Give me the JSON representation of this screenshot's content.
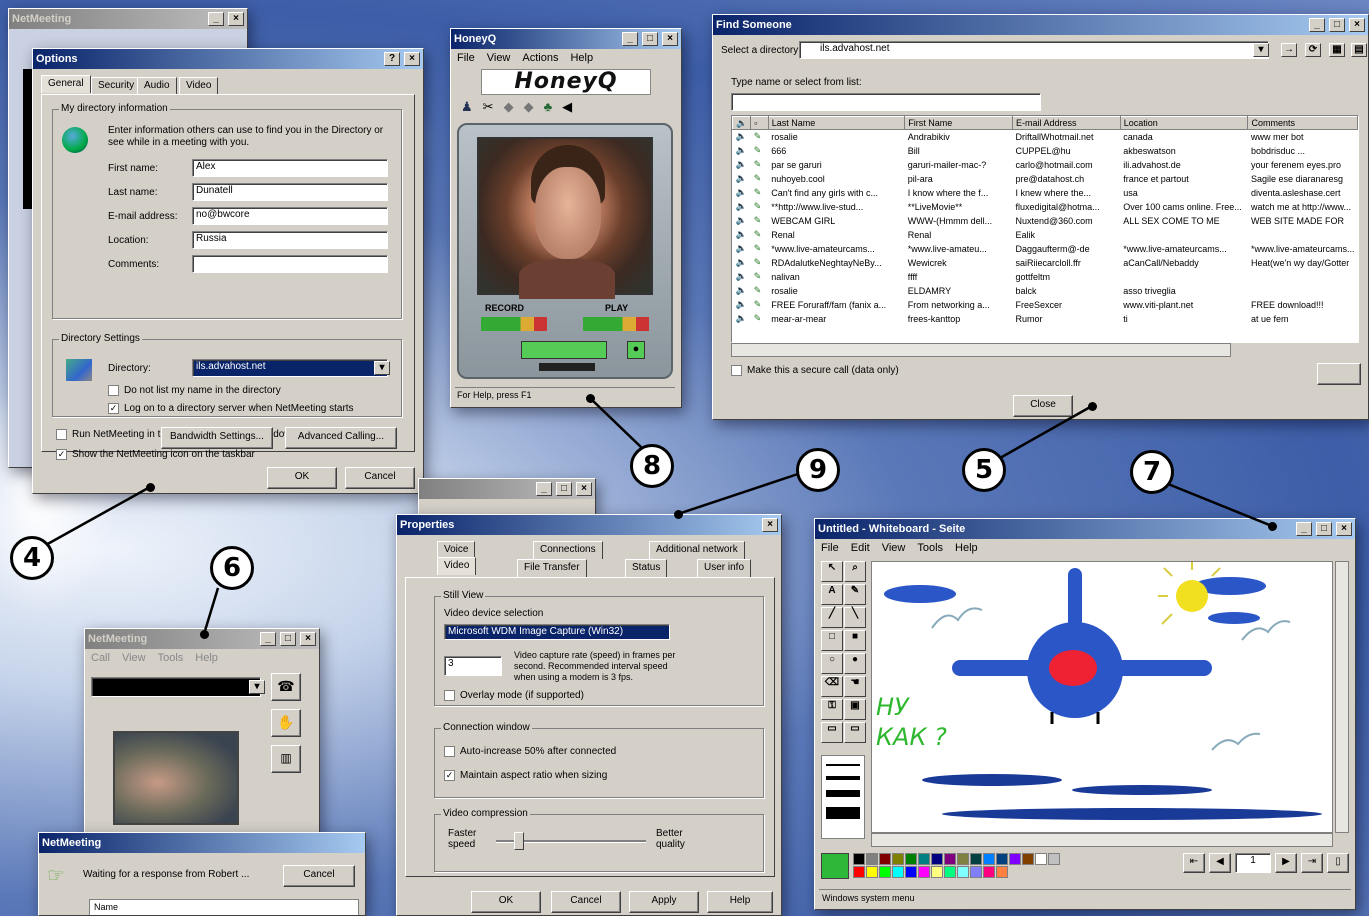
{
  "callouts": [
    "4",
    "5",
    "6",
    "7",
    "8",
    "9"
  ],
  "options": {
    "title": "Options",
    "tabs": [
      "General",
      "Security",
      "Audio",
      "Video"
    ],
    "my_dir_group": "My directory information",
    "intro": "Enter information others can use to find you in the Directory or see while in a meeting with you.",
    "fields": [
      {
        "label": "First name:",
        "value": "Alex"
      },
      {
        "label": "Last name:",
        "value": "Dunatell"
      },
      {
        "label": "E-mail address:",
        "value": "no@bwcore"
      },
      {
        "label": "Location:",
        "value": "Russia"
      },
      {
        "label": "Comments:",
        "value": ""
      }
    ],
    "dir_group": "Directory Settings",
    "dir_label": "Directory:",
    "dir_value": "ils.advahost.net",
    "chk1": "Do not list my name in the directory",
    "chk2": "Log on to a directory server when NetMeeting starts",
    "chk3": "Run NetMeeting in the background when Windows starts",
    "chk4": "Show the NetMeeting icon on the taskbar",
    "bandwidth": "Bandwidth Settings...",
    "advanced": "Advanced Calling...",
    "ok": "OK",
    "cancel": "Cancel"
  },
  "honeyq": {
    "title": "HoneyQ",
    "menu": [
      "File",
      "View",
      "Actions",
      "Help"
    ],
    "logo": "HoneyQ",
    "record": "RECORD",
    "play": "PLAY",
    "status": "For Help, press F1"
  },
  "find": {
    "title": "Find Someone",
    "dir_label": "Select a directory:",
    "dir_value": "ils.advahost.net",
    "search_label": "Type name or select from list:",
    "search_value": "",
    "columns": [
      "Last Name",
      "First Name",
      "E-mail Address",
      "Location",
      "Comments"
    ],
    "rows": [
      [
        "rosalie",
        "Andrabikiv",
        "DriftallWhotmail.net",
        "canada",
        "www mer bot"
      ],
      [
        "666",
        "Bill",
        "CUPPEL@hu",
        "akbeswatson",
        "bobdrisduc ..."
      ],
      [
        "par se garuri",
        "garuri-mailer-mac-?",
        "carlo@hotmail.com",
        "ili.advahost.de",
        "your ferenem eyes.pro"
      ],
      [
        "nuhoyeb.cool",
        "pil-ara",
        "pre@datahost.ch",
        "france et partout",
        "Sagile ese diaranaresg"
      ],
      [
        "Can't find any girls with c...",
        "I know where the f...",
        "I knew where the...",
        "usa",
        "diventa.asleshase.cert"
      ],
      [
        "**http://www.live-stud...",
        "**LiveMovie**",
        "fluxedigital@hotma...",
        "Over 100 cams online. Free...",
        "watch me at http://www..."
      ],
      [
        "WEBCAM  GIRL",
        "WWW-(Hmmm dell...",
        "Nuxtend@360.com",
        "ALL  SEX  COME  TO  ME",
        "WEB  SITE  MADE  FOR"
      ],
      [
        "Renal",
        "Renal",
        "Ealik",
        "",
        ""
      ],
      [
        "*www.live-amateurcams...",
        "*www.live-amateu...",
        "Daggaufterm@-de",
        "*www.live-amateurcams...",
        "*www.live-amateurcams..."
      ],
      [
        "RDAdalutkeNeghtayNeBy...",
        "Wewicrek",
        "saiRiiecarcloll.ffr",
        "aCanCall/Nebaddy",
        "Heat(we'n wy day/Gotter"
      ],
      [
        "nalivan",
        "ffff",
        "gottfeltm",
        "",
        ""
      ],
      [
        "rosalie",
        "ELDAMRY",
        "balck",
        "asso triveglia",
        ""
      ],
      [
        "FREE Foruraff/fam (fanix a...",
        "From networking a...",
        "FreeSexcer",
        "www.viti-plant.net",
        "FREE  download!!!"
      ],
      [
        "mear-ar-mear",
        "frees-kanttop",
        "Rumor",
        "ti",
        "at ue fem"
      ]
    ],
    "chk": "Make this a secure call (data only)",
    "close": "Close"
  },
  "whiteboard": {
    "title": "Untitled - Whiteboard - Seite",
    "menu": [
      "File",
      "Edit",
      "View",
      "Tools",
      "Help"
    ],
    "handwriting": "НУ КАК ?",
    "page": "1",
    "status": "Windows system menu",
    "palette": [
      "#000000",
      "#808080",
      "#800000",
      "#808000",
      "#008000",
      "#008080",
      "#000080",
      "#800080",
      "#808040",
      "#004040",
      "#0080ff",
      "#004080",
      "#8000ff",
      "#804000",
      "#ffffff",
      "#c0c0c0",
      "#ff0000",
      "#ffff00",
      "#00ff00",
      "#00ffff",
      "#0000ff",
      "#ff00ff",
      "#ffff80",
      "#00ff80",
      "#80ffff",
      "#8080ff",
      "#ff0080",
      "#ff8040"
    ],
    "current_color": "#2db83a"
  },
  "props": {
    "title": "Properties",
    "tabs_back": [
      "Voice",
      "Connections",
      "Additional network"
    ],
    "tabs_front": [
      "Video",
      "File Transfer",
      "Status",
      "User info"
    ],
    "group1": "Still View",
    "dev_label": "Video device selection",
    "dev_value": "Microsoft WDM Image Capture (Win32)",
    "rate_value": "3",
    "rate_desc": "Video capture rate (speed) in frames per second. Recommended interval speed when using a modem is 3 fps.",
    "overlay": "Overlay mode (if supported)",
    "group2": "Connection window",
    "c1": "Auto-increase 50% after connected",
    "c2": "Maintain aspect ratio when sizing",
    "group3": "Video compression",
    "faster": "Faster speed",
    "better": "Better quality",
    "ok": "OK",
    "cancel": "Cancel",
    "apply": "Apply",
    "help": "Help"
  },
  "mini": {
    "title": "NetMeeting",
    "menu": [
      "Call",
      "View",
      "Tools",
      "Help"
    ]
  },
  "netmeeting": {
    "title": "NetMeeting",
    "msg": "Waiting for a response from Robert ...",
    "cancel": "Cancel",
    "name_col": "Name"
  }
}
